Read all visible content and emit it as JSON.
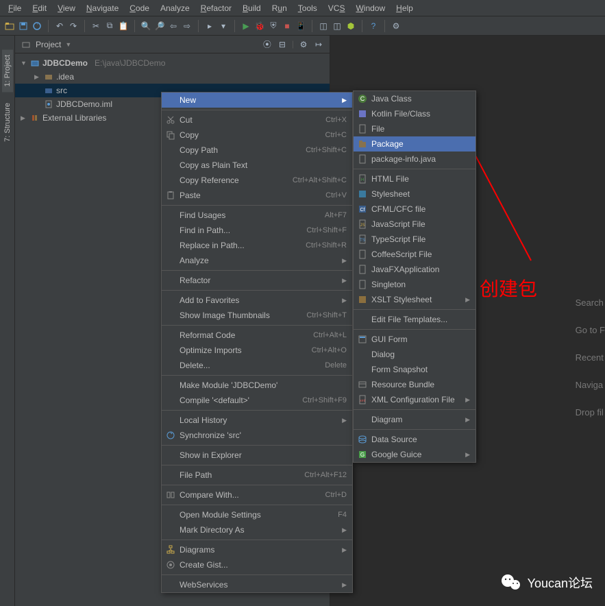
{
  "menubar": [
    "File",
    "Edit",
    "View",
    "Navigate",
    "Code",
    "Analyze",
    "Refactor",
    "Build",
    "Run",
    "Tools",
    "VCS",
    "Window",
    "Help"
  ],
  "menubar_u": [
    "F",
    "E",
    "V",
    "N",
    "C",
    "",
    "R",
    "B",
    "u",
    "T",
    "S",
    "W",
    "H"
  ],
  "panel": {
    "title": "Project"
  },
  "leftbar": {
    "project": "1: Project",
    "structure": "7: Structure"
  },
  "tree": {
    "root": "JDBCDemo",
    "root_path": "E:\\java\\JDBCDemo",
    "idea": ".idea",
    "src": "src",
    "iml": "JDBCDemo.iml",
    "ext": "External Libraries"
  },
  "context": [
    {
      "label": "New",
      "sub": true,
      "hi": true
    },
    {
      "sep": true
    },
    {
      "label": "Cut",
      "icon": "cut",
      "sc": "Ctrl+X"
    },
    {
      "label": "Copy",
      "icon": "copy",
      "sc": "Ctrl+C"
    },
    {
      "label": "Copy Path",
      "sc": "Ctrl+Shift+C"
    },
    {
      "label": "Copy as Plain Text"
    },
    {
      "label": "Copy Reference",
      "sc": "Ctrl+Alt+Shift+C"
    },
    {
      "label": "Paste",
      "icon": "paste",
      "sc": "Ctrl+V"
    },
    {
      "sep": true
    },
    {
      "label": "Find Usages",
      "sc": "Alt+F7"
    },
    {
      "label": "Find in Path...",
      "sc": "Ctrl+Shift+F"
    },
    {
      "label": "Replace in Path...",
      "sc": "Ctrl+Shift+R"
    },
    {
      "label": "Analyze",
      "sub": true
    },
    {
      "sep": true
    },
    {
      "label": "Refactor",
      "sub": true
    },
    {
      "sep": true
    },
    {
      "label": "Add to Favorites",
      "sub": true
    },
    {
      "label": "Show Image Thumbnails",
      "sc": "Ctrl+Shift+T"
    },
    {
      "sep": true
    },
    {
      "label": "Reformat Code",
      "sc": "Ctrl+Alt+L"
    },
    {
      "label": "Optimize Imports",
      "sc": "Ctrl+Alt+O"
    },
    {
      "label": "Delete...",
      "sc": "Delete"
    },
    {
      "sep": true
    },
    {
      "label": "Make Module 'JDBCDemo'"
    },
    {
      "label": "Compile '<default>'",
      "sc": "Ctrl+Shift+F9"
    },
    {
      "sep": true
    },
    {
      "label": "Local History",
      "sub": true
    },
    {
      "label": "Synchronize 'src'",
      "icon": "sync"
    },
    {
      "sep": true
    },
    {
      "label": "Show in Explorer"
    },
    {
      "sep": true
    },
    {
      "label": "File Path",
      "sc": "Ctrl+Alt+F12"
    },
    {
      "sep": true
    },
    {
      "label": "Compare With...",
      "icon": "compare",
      "sc": "Ctrl+D"
    },
    {
      "sep": true
    },
    {
      "label": "Open Module Settings",
      "sc": "F4"
    },
    {
      "label": "Mark Directory As",
      "sub": true
    },
    {
      "sep": true
    },
    {
      "label": "Diagrams",
      "icon": "diagram",
      "sub": true
    },
    {
      "label": "Create Gist...",
      "icon": "gist"
    },
    {
      "sep": true
    },
    {
      "label": "WebServices",
      "sub": true
    }
  ],
  "submenu": [
    {
      "label": "Java Class",
      "icon": "class"
    },
    {
      "label": "Kotlin File/Class",
      "icon": "kotlin"
    },
    {
      "label": "File",
      "icon": "file"
    },
    {
      "label": "Package",
      "icon": "package",
      "hi": true
    },
    {
      "label": "package-info.java",
      "icon": "file"
    },
    {
      "sep": true
    },
    {
      "label": "HTML File",
      "icon": "html"
    },
    {
      "label": "Stylesheet",
      "icon": "css"
    },
    {
      "label": "CFML/CFC file",
      "icon": "cf"
    },
    {
      "label": "JavaScript File",
      "icon": "js"
    },
    {
      "label": "TypeScript File",
      "icon": "ts"
    },
    {
      "label": "CoffeeScript File",
      "icon": "coffee"
    },
    {
      "label": "JavaFXApplication",
      "icon": "fx"
    },
    {
      "label": "Singleton",
      "icon": "single"
    },
    {
      "label": "XSLT Stylesheet",
      "icon": "xslt",
      "sub": true
    },
    {
      "sep": true
    },
    {
      "label": "Edit File Templates..."
    },
    {
      "sep": true
    },
    {
      "label": "GUI Form",
      "icon": "gui"
    },
    {
      "label": "Dialog"
    },
    {
      "label": "Form Snapshot"
    },
    {
      "label": "Resource Bundle",
      "icon": "bundle"
    },
    {
      "label": "XML Configuration File",
      "icon": "xml",
      "sub": true
    },
    {
      "sep": true
    },
    {
      "label": "Diagram",
      "sub": true
    },
    {
      "sep": true
    },
    {
      "label": "Data Source",
      "icon": "ds"
    },
    {
      "label": "Google Guice",
      "icon": "guice",
      "sub": true
    }
  ],
  "hints": [
    "Search",
    "Go to F",
    "Recent",
    "Naviga",
    "Drop fil"
  ],
  "annotation": "创建包",
  "watermark": "Youcan论坛"
}
